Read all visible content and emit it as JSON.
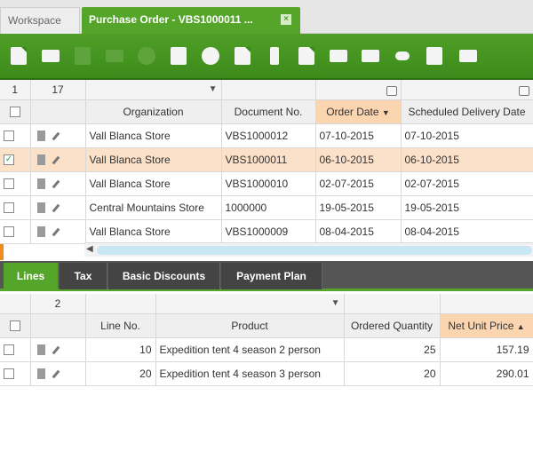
{
  "window_tabs": [
    {
      "label": "Workspace"
    },
    {
      "label": "Purchase Order - VBS1000011 ..."
    }
  ],
  "close_glyph": "×",
  "toolbar": {
    "icons": [
      "new-document-icon",
      "save-form-icon",
      "save-icon",
      "new-record-icon",
      "cancel-icon",
      "delete-icon",
      "refresh-icon",
      "export-icon",
      "attachment-icon",
      "copy-icon",
      "print-icon",
      "email-icon",
      "link-icon",
      "tools-icon",
      "grid-view-icon"
    ]
  },
  "top_grid": {
    "selected_count": "1",
    "total_count": "17",
    "columns": [
      "Organization",
      "Document No.",
      "Order Date",
      "Scheduled Delivery Date"
    ],
    "sort_indicator": "▼",
    "rows": [
      {
        "organization": "Vall Blanca Store",
        "document_no": "VBS1000012",
        "order_date": "07-10-2015",
        "delivery_date": "07-10-2015",
        "checked": ""
      },
      {
        "organization": "Vall Blanca Store",
        "document_no": "VBS1000011",
        "order_date": "06-10-2015",
        "delivery_date": "06-10-2015",
        "checked": "✓"
      },
      {
        "organization": "Vall Blanca Store",
        "document_no": "VBS1000010",
        "order_date": "02-07-2015",
        "delivery_date": "02-07-2015",
        "checked": ""
      },
      {
        "organization": "Central Mountains Store",
        "document_no": "1000000",
        "order_date": "19-05-2015",
        "delivery_date": "19-05-2015",
        "checked": ""
      },
      {
        "organization": "Vall Blanca Store",
        "document_no": "VBS1000009",
        "order_date": "08-04-2015",
        "delivery_date": "08-04-2015",
        "checked": ""
      }
    ]
  },
  "sub_tabs": [
    "Lines",
    "Tax",
    "Basic Discounts",
    "Payment Plan"
  ],
  "lines_grid": {
    "total_count": "2",
    "columns": [
      "Line No.",
      "Product",
      "Ordered Quantity",
      "Net Unit Price"
    ],
    "sort_indicator": "▲",
    "rows": [
      {
        "line_no": "10",
        "product": "Expedition tent 4 season 2 person",
        "qty": "25",
        "price": "157.19"
      },
      {
        "line_no": "20",
        "product": "Expedition tent 4 season 3 person",
        "qty": "20",
        "price": "290.01"
      }
    ]
  },
  "colors": {
    "accent_green": "#55a52b",
    "selection_orange": "#fbe1c8",
    "sort_header": "#fbd5b0"
  }
}
